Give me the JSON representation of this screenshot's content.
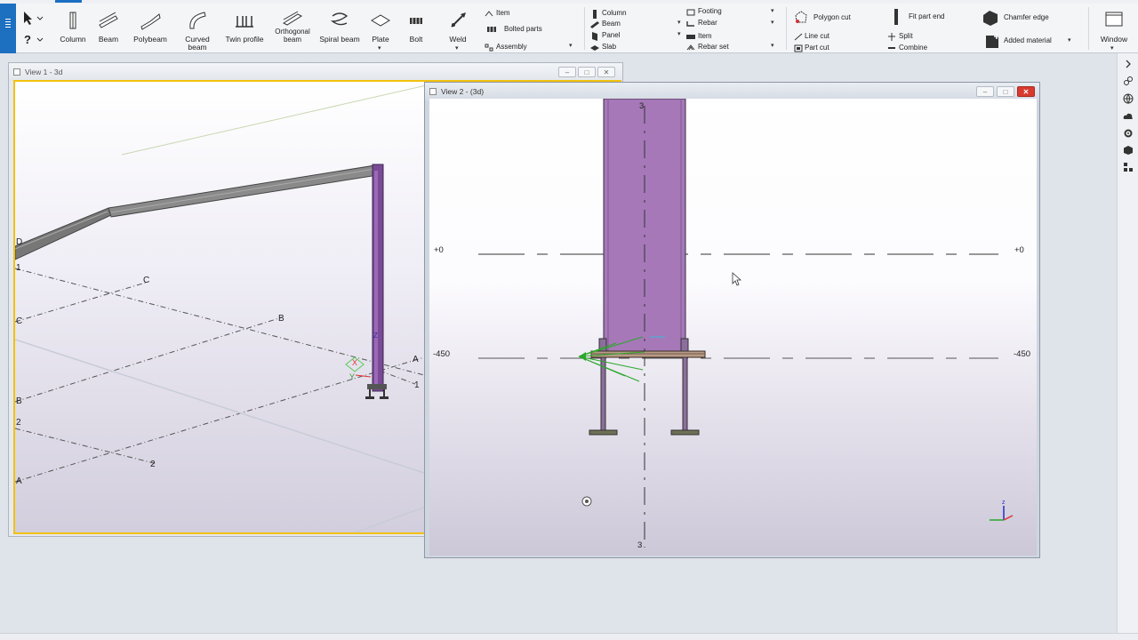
{
  "toolbar": {
    "main_buttons": [
      {
        "label": "Column",
        "icon": "column-icon"
      },
      {
        "label": "Beam",
        "icon": "beam-icon"
      },
      {
        "label": "Polybeam",
        "icon": "polybeam-icon"
      },
      {
        "label": "Curved beam",
        "icon": "curved-beam-icon"
      },
      {
        "label": "Twin profile",
        "icon": "twin-profile-icon"
      },
      {
        "label": "Orthogonal beam",
        "icon": "orthogonal-beam-icon"
      },
      {
        "label": "Spiral beam",
        "icon": "spiral-beam-icon"
      },
      {
        "label": "Plate",
        "icon": "plate-icon"
      },
      {
        "label": "Bolt",
        "icon": "bolt-icon"
      },
      {
        "label": "Weld",
        "icon": "weld-icon"
      }
    ],
    "steel_small": [
      {
        "label": "Item",
        "icon": "item-icon"
      },
      {
        "label": "Bolted parts",
        "icon": "bolted-parts-icon"
      },
      {
        "label": "Assembly",
        "icon": "assembly-icon"
      }
    ],
    "concrete_small": [
      {
        "label": "Column",
        "icon": "concrete-column-icon"
      },
      {
        "label": "Beam",
        "icon": "concrete-beam-icon"
      },
      {
        "label": "Panel",
        "icon": "panel-icon"
      },
      {
        "label": "Slab",
        "icon": "slab-icon"
      }
    ],
    "concrete_small_2": [
      {
        "label": "Footing",
        "icon": "footing-icon"
      },
      {
        "label": "Rebar",
        "icon": "rebar-icon"
      },
      {
        "label": "Item",
        "icon": "concrete-item-icon"
      },
      {
        "label": "Rebar set",
        "icon": "rebar-set-icon"
      }
    ],
    "edit_small": [
      {
        "label": "Polygon cut",
        "icon": "polygon-cut-icon"
      },
      {
        "label": "Line cut",
        "icon": "line-cut-icon"
      },
      {
        "label": "Part cut",
        "icon": "part-cut-icon"
      },
      {
        "label": "Fit part end",
        "icon": "fit-part-end-icon"
      },
      {
        "label": "Split",
        "icon": "split-icon"
      },
      {
        "label": "Combine",
        "icon": "combine-icon"
      },
      {
        "label": "Chamfer edge",
        "icon": "chamfer-edge-icon"
      },
      {
        "label": "Added material",
        "icon": "added-material-icon"
      }
    ],
    "window_label": "Window"
  },
  "views": {
    "view1": {
      "title": "View 1 - 3d",
      "grid_labels": [
        "D",
        "1",
        "C",
        "C",
        "B",
        "B",
        "2",
        "2",
        "A",
        "A",
        "1"
      ],
      "axis_labels": [
        "X",
        "Y",
        "Z"
      ]
    },
    "view2": {
      "title": "View 2 - (3d)",
      "grid_top": "3",
      "grid_bottom": "3",
      "level_top_left": "+0",
      "level_top_right": "+0",
      "level_mid_left": "-450",
      "level_mid_right": "-450"
    }
  },
  "colors": {
    "accent": "#1d6fc0",
    "column": "#a678b8",
    "active_frame": "#f2c10d",
    "baseplate": "#b89a86",
    "close": "#d83a2f"
  }
}
